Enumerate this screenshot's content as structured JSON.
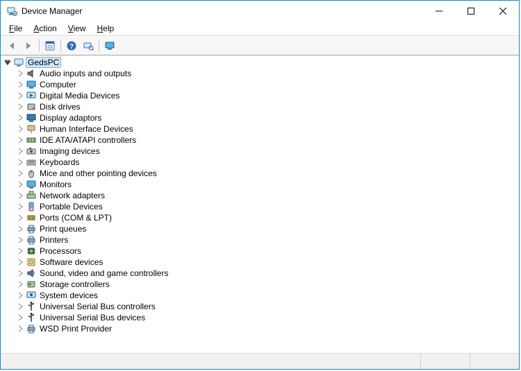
{
  "window": {
    "title": "Device Manager"
  },
  "menu": {
    "file": "File",
    "action": "Action",
    "view": "View",
    "help": "Help"
  },
  "toolbar": {
    "back": "back-icon",
    "forward": "forward-icon",
    "properties": "properties-icon",
    "help": "help-icon",
    "scan": "scan-icon",
    "show": "show-monitor-icon"
  },
  "tree": {
    "root": {
      "label": "GedsPC",
      "icon": "computer-icon"
    },
    "children": [
      {
        "label": "Audio inputs and outputs",
        "icon": "audio-icon"
      },
      {
        "label": "Computer",
        "icon": "monitor-icon"
      },
      {
        "label": "Digital Media Devices",
        "icon": "media-icon"
      },
      {
        "label": "Disk drives",
        "icon": "disk-icon"
      },
      {
        "label": "Display adaptors",
        "icon": "display-icon"
      },
      {
        "label": "Human Interface Devices",
        "icon": "hid-icon"
      },
      {
        "label": "IDE ATA/ATAPI controllers",
        "icon": "ide-icon"
      },
      {
        "label": "Imaging devices",
        "icon": "imaging-icon"
      },
      {
        "label": "Keyboards",
        "icon": "keyboard-icon"
      },
      {
        "label": "Mice and other pointing devices",
        "icon": "mouse-icon"
      },
      {
        "label": "Monitors",
        "icon": "monitor-icon"
      },
      {
        "label": "Network adapters",
        "icon": "network-icon"
      },
      {
        "label": "Portable Devices",
        "icon": "portable-icon"
      },
      {
        "label": "Ports (COM & LPT)",
        "icon": "port-icon"
      },
      {
        "label": "Print queues",
        "icon": "printer-icon"
      },
      {
        "label": "Printers",
        "icon": "printer-icon"
      },
      {
        "label": "Processors",
        "icon": "cpu-icon"
      },
      {
        "label": "Software devices",
        "icon": "software-icon"
      },
      {
        "label": "Sound, video and game controllers",
        "icon": "sound-icon"
      },
      {
        "label": "Storage controllers",
        "icon": "storage-icon"
      },
      {
        "label": "System devices",
        "icon": "system-icon"
      },
      {
        "label": "Universal Serial Bus controllers",
        "icon": "usb-icon"
      },
      {
        "label": "Universal Serial Bus devices",
        "icon": "usb-icon"
      },
      {
        "label": "WSD Print Provider",
        "icon": "printer-icon"
      }
    ]
  }
}
